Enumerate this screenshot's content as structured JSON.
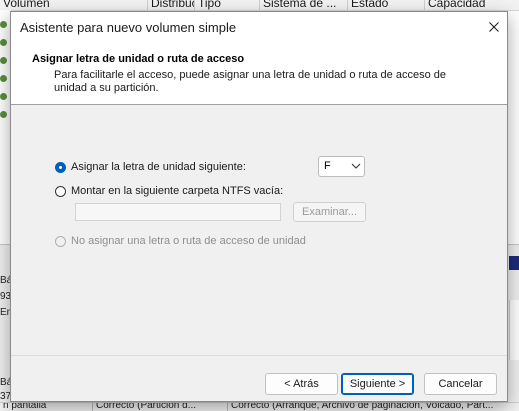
{
  "background_window": {
    "columns": [
      "Volumen",
      "Distribución",
      "Tipo",
      "Sistema de ...",
      "Estado",
      "Capacidad"
    ],
    "left_fragments": [
      "Bá",
      "93",
      "En",
      "Bá",
      "37"
    ],
    "bottom_items": [
      "n pantalla",
      "Correcto (Partición d...",
      "Correcto (Arranque, Archivo de paginación, Volcado, Part..."
    ]
  },
  "dialog": {
    "title": "Asistente para nuevo volumen simple",
    "header": {
      "title": "Asignar letra de unidad o ruta de acceso",
      "description": "Para facilitarle el acceso, puede asignar una letra de unidad o ruta de acceso de unidad a su partición."
    },
    "options": {
      "assign_letter": {
        "label": "Asignar la letra de unidad siguiente:",
        "selected": true
      },
      "mount_folder": {
        "label": "Montar en la siguiente carpeta NTFS vacía:",
        "selected": false
      },
      "no_assign": {
        "label": "No asignar una letra o ruta de acceso de unidad",
        "selected": false,
        "disabled": true
      }
    },
    "drive_letter": {
      "value": "F"
    },
    "folder_path": {
      "value": ""
    },
    "browse_label": "Examinar...",
    "buttons": {
      "back": "< Atrás",
      "next": "Siguiente >",
      "cancel": "Cancelar"
    },
    "colors": {
      "accent": "#005fb8",
      "dialog_bg": "#f0f0f0",
      "header_bg": "#ffffff"
    },
    "icons": {
      "close": "close-icon",
      "dropdown": "chevron-down-icon"
    }
  }
}
